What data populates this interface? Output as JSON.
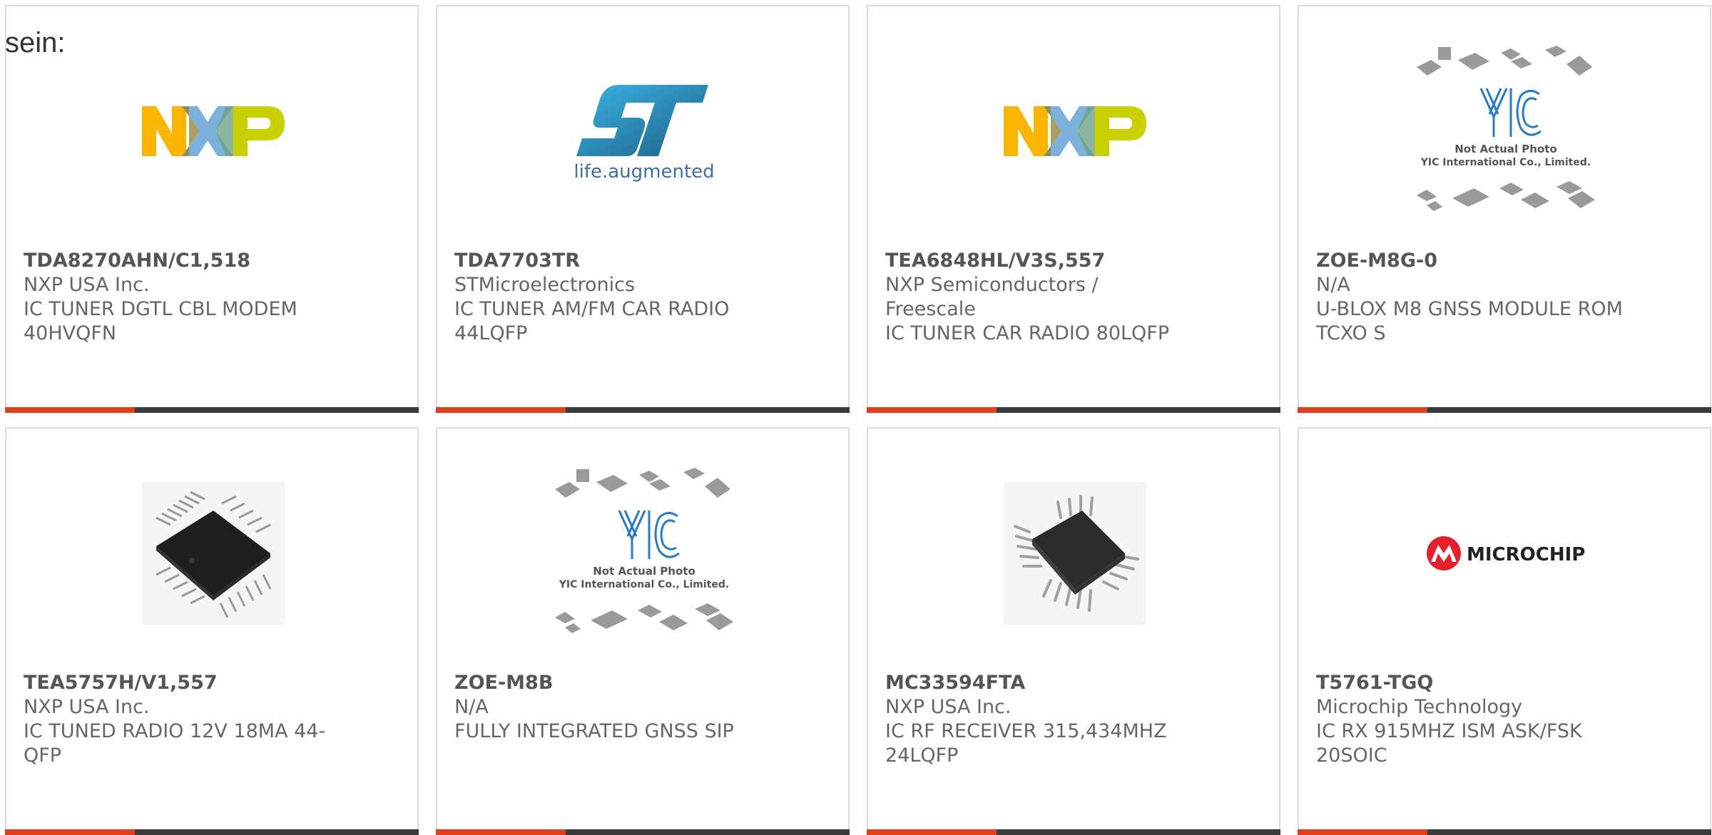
{
  "intro_text": "sein:",
  "colors": {
    "accent": "#e2401c",
    "bar": "#3b3b3b",
    "text": "#666666",
    "border": "#dddddd"
  },
  "products": [
    {
      "part": "TDA8270AHN/C1,518",
      "maker": "NXP USA Inc.",
      "desc": "IC TUNER DGTL CBL MODEM 40HVQFN",
      "image": "nxp-logo"
    },
    {
      "part": "TDA7703TR",
      "maker": "STMicroelectronics",
      "desc": "IC TUNER AM/FM CAR RADIO 44LQFP",
      "image": "st-logo",
      "logo_text": "life.augmented"
    },
    {
      "part": "TEA6848HL/V3S,557",
      "maker": "NXP Semiconductors / Freescale",
      "desc": "IC TUNER CAR RADIO 80LQFP",
      "image": "nxp-logo"
    },
    {
      "part": "ZOE-M8G-0",
      "maker": "N/A",
      "desc": "U-BLOX M8 GNSS MODULE ROM TCXO S",
      "image": "yic-placeholder",
      "note1": "Not Actual Photo",
      "note2": "YIC International Co., Limited."
    },
    {
      "part": "TEA5757H/V1,557",
      "maker": "NXP USA Inc.",
      "desc": "IC TUNED RADIO 12V 18MA 44-QFP",
      "image": "qfp-chip-photo"
    },
    {
      "part": "ZOE-M8B",
      "maker": "N/A",
      "desc": "FULLY INTEGRATED GNSS SIP",
      "image": "yic-placeholder",
      "note1": "Not Actual Photo",
      "note2": "YIC International Co., Limited."
    },
    {
      "part": "MC33594FTA",
      "maker": "NXP USA Inc.",
      "desc": "IC RF RECEIVER 315,434MHZ 24LQFP",
      "image": "lqfp-chip-photo"
    },
    {
      "part": "T5761-TGQ",
      "maker": "Microchip Technology",
      "desc": "IC RX 915MHZ ISM ASK/FSK 20SOIC",
      "image": "microchip-logo",
      "logo_text": "MICROCHIP"
    }
  ]
}
